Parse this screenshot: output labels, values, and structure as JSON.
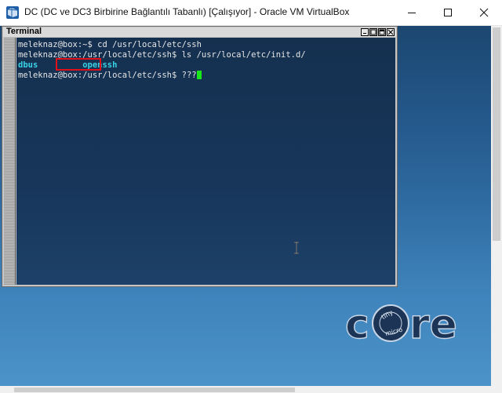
{
  "host_window": {
    "title": "DC (DC ve DC3 Birbirine Bağlantılı Tabanlı) [Çalışıyor] - Oracle VM VirtualBox",
    "app_icon": "virtualbox-icon",
    "controls": [
      "minimize-icon",
      "maximize-icon",
      "close-icon"
    ]
  },
  "terminal": {
    "title": "Terminal",
    "title_buttons": [
      "iconify-icon",
      "shade-icon",
      "maximize-icon",
      "close-icon"
    ],
    "lines": {
      "l1": "meleknaz@box:~$ cd /usr/local/etc/ssh",
      "l2": "meleknaz@box:/usr/local/etc/ssh$ ls /usr/local/etc/init.d/",
      "l4_prompt": "meleknaz@box:/usr/local/etc/ssh$ ",
      "l4_input": "???"
    },
    "ls_output": [
      "dbus",
      "openssh"
    ],
    "highlighted_entry": "openssh",
    "colors": {
      "directory": "#38d3e6",
      "cursor": "#19e619",
      "highlight_border": "#e0101a"
    }
  },
  "desktop": {
    "logo": {
      "letters_left": "c",
      "letters_right": "re",
      "badge_top": "tiny",
      "badge_bottom": "micro"
    }
  }
}
